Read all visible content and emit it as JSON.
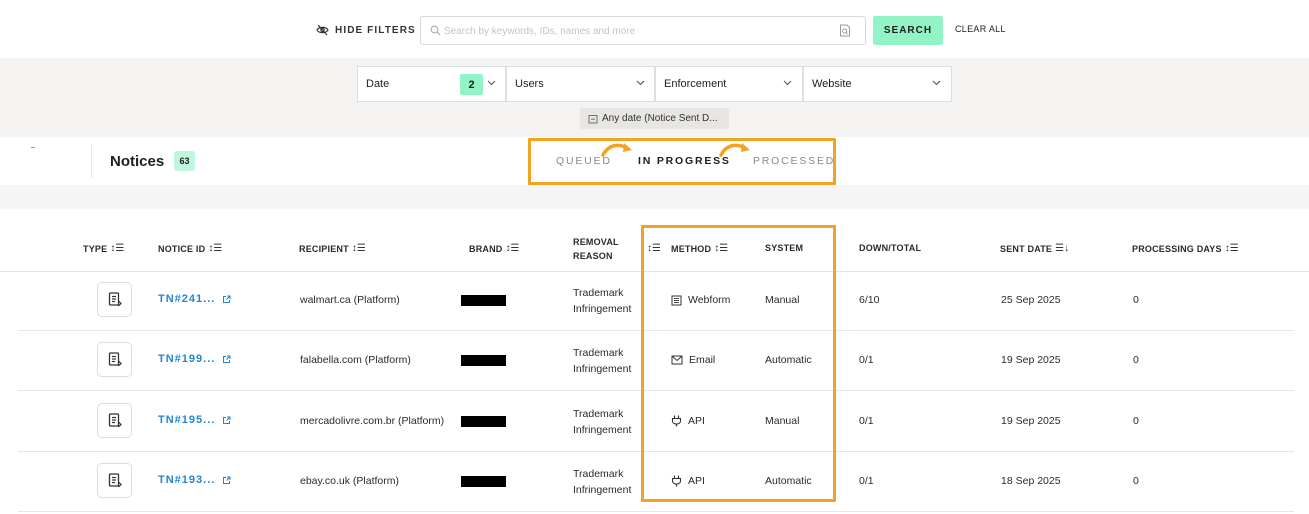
{
  "filters_bar": {
    "hide_filters_label": "HIDE FILTERS",
    "search_placeholder": "Search by keywords, IDs, names and more",
    "search_button": "SEARCH",
    "clear_all": "CLEAR ALL"
  },
  "dropdowns": {
    "date": {
      "label": "Date",
      "count": "2"
    },
    "users": {
      "label": "Users"
    },
    "enforcement": {
      "label": "Enforcement"
    },
    "website": {
      "label": "Website"
    }
  },
  "active_filter_chip": "Any date (Notice Sent D...",
  "notices": {
    "title": "Notices",
    "count": "63"
  },
  "status_tabs": [
    {
      "label": "QUEUED",
      "active": false
    },
    {
      "label": "IN PROGRESS",
      "active": true
    },
    {
      "label": "PROCESSED",
      "active": false
    }
  ],
  "table": {
    "columns": {
      "type": "TYPE",
      "notice_id": "NOTICE ID",
      "recipient": "RECIPIENT",
      "brand": "BRAND",
      "removal_reason_line1": "REMOVAL",
      "removal_reason_line2": "REASON",
      "method": "METHOD",
      "system": "SYSTEM",
      "down_total": "DOWN/TOTAL",
      "sent_date": "SENT DATE",
      "processing_days": "PROCESSING DAYS"
    },
    "rows": [
      {
        "type_icon": "document-icon",
        "notice_id": "TN#241...",
        "recipient": "walmart.ca (Platform)",
        "brand": "",
        "reason_line1": "Trademark",
        "reason_line2": "Infringement",
        "method_icon": "webform-icon",
        "method": "Webform",
        "system": "Manual",
        "down_total": "6/10",
        "sent_date": "25 Sep 2025",
        "processing_days": "0"
      },
      {
        "type_icon": "document-icon",
        "notice_id": "TN#199...",
        "recipient": "falabella.com (Platform)",
        "brand": "",
        "reason_line1": "Trademark",
        "reason_line2": "Infringement",
        "method_icon": "mail-icon",
        "method": "Email",
        "system": "Automatic",
        "down_total": "0/1",
        "sent_date": "19 Sep 2025",
        "processing_days": "0"
      },
      {
        "type_icon": "document-icon",
        "notice_id": "TN#195...",
        "recipient": "mercadolivre.com.br (Platform)",
        "brand": "",
        "reason_line1": "Trademark",
        "reason_line2": "Infringement",
        "method_icon": "plug-icon",
        "method": "API",
        "system": "Manual",
        "down_total": "0/1",
        "sent_date": "19 Sep 2025",
        "processing_days": "0"
      },
      {
        "type_icon": "document-icon",
        "notice_id": "TN#193...",
        "recipient": "ebay.co.uk (Platform)",
        "brand": "",
        "reason_line1": "Trademark",
        "reason_line2": "Infringement",
        "method_icon": "plug-icon",
        "method": "API",
        "system": "Automatic",
        "down_total": "0/1",
        "sent_date": "18 Sep 2025",
        "processing_days": "0"
      }
    ]
  },
  "colors": {
    "accent_green": "#92f3c7",
    "highlight_orange": "#f2a324",
    "link_blue": "#1f86d6"
  }
}
